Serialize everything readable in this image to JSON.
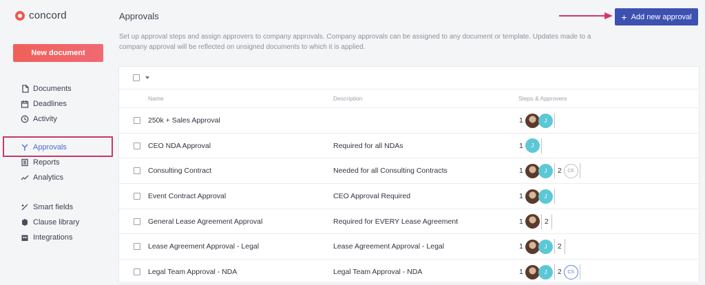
{
  "app": {
    "name": "concord"
  },
  "sidebar": {
    "new_document": "New document",
    "group1": [
      {
        "label": "Documents",
        "icon": "document-icon"
      },
      {
        "label": "Deadlines",
        "icon": "calendar-icon"
      },
      {
        "label": "Activity",
        "icon": "clock-icon"
      }
    ],
    "group2": [
      {
        "label": "Approvals",
        "icon": "approvals-icon",
        "active": true
      },
      {
        "label": "Reports",
        "icon": "reports-icon"
      },
      {
        "label": "Analytics",
        "icon": "analytics-icon"
      }
    ],
    "group3": [
      {
        "label": "Smart fields",
        "icon": "smart-fields-icon"
      },
      {
        "label": "Clause library",
        "icon": "clause-library-icon"
      },
      {
        "label": "Integrations",
        "icon": "integrations-icon"
      }
    ]
  },
  "header": {
    "title": "Approvals",
    "add_button": "Add new approval",
    "intro": "Set up approval steps and assign approvers to company approvals. Company approvals can be assigned to any document or template. Updates made to a company approval will be reflected on unsigned documents to which it is applied."
  },
  "table": {
    "columns": [
      "Name",
      "Description",
      "Steps & Approvers"
    ],
    "rows": [
      {
        "name": "250k + Sales Approval",
        "description": "",
        "steps": [
          {
            "num": "1",
            "avatars": [
              "photo",
              "J"
            ]
          }
        ]
      },
      {
        "name": "CEO NDA Approval",
        "description": "Required for all NDAs",
        "steps": [
          {
            "num": "1",
            "avatars": [
              "J"
            ]
          }
        ]
      },
      {
        "name": "Consulting Contract",
        "description": "Needed for all Consulting Contracts",
        "steps": [
          {
            "num": "1",
            "avatars": [
              "photo",
              "J"
            ]
          },
          {
            "num": "2",
            "avatars": [
              "CE"
            ]
          }
        ]
      },
      {
        "name": "Event Contract Approval",
        "description": "CEO Approval Required",
        "steps": [
          {
            "num": "1",
            "avatars": [
              "photo",
              "J"
            ]
          }
        ]
      },
      {
        "name": "General Lease Agreement Approval",
        "description": "Required for EVERY Lease Agreement",
        "steps": [
          {
            "num": "1",
            "avatars": [
              "photo"
            ]
          },
          {
            "num": "2",
            "avatars": []
          }
        ]
      },
      {
        "name": "Lease Agreement Approval - Legal",
        "description": "Lease Agreement Approval - Legal",
        "steps": [
          {
            "num": "1",
            "avatars": [
              "photo",
              "J"
            ]
          },
          {
            "num": "2",
            "avatars": []
          }
        ]
      },
      {
        "name": "Legal Team Approval - NDA",
        "description": "Legal Team Approval - NDA",
        "steps": [
          {
            "num": "1",
            "avatars": [
              "photo",
              "J"
            ]
          },
          {
            "num": "2",
            "avatars": [
              "CS"
            ]
          }
        ]
      }
    ]
  },
  "colors": {
    "accent": "#3d51b0",
    "new_doc": "#f0605a",
    "highlight": "#c8366b",
    "active_nav": "#4b6ccc"
  }
}
